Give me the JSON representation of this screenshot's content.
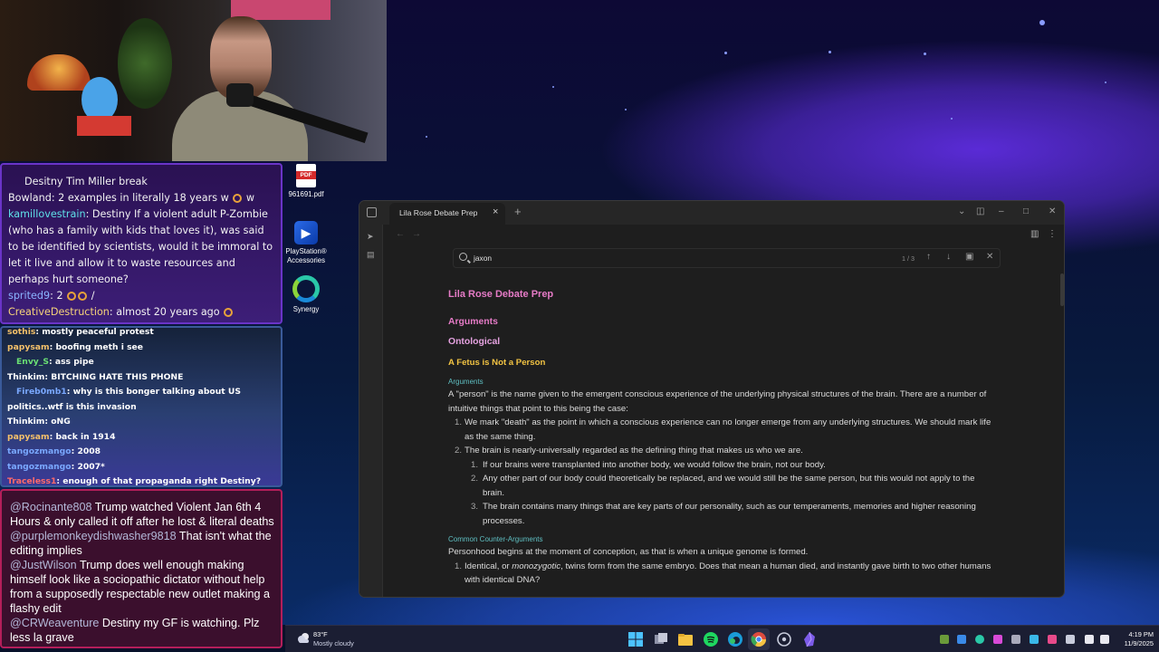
{
  "chat_overlay_1": {
    "messages": [
      {
        "user": "",
        "text": "Desitny Tim Miller break"
      },
      {
        "user": "Bowland",
        "text": ": 2 examples in literally 18 years w",
        "suffix": "w"
      },
      {
        "user": "kamillovestrain",
        "text": ": Destiny If a violent adult P-Zombie (who has a family with kids that loves it), was said to be identified by scientists, would it be immoral to let it live and allow it to waste resources and perhaps hurt someone?"
      },
      {
        "user": "sprited9",
        "text": ": 2",
        "suffix": "/"
      },
      {
        "user": "CreativeDestruction",
        "text": ": almost 20 years ago"
      }
    ]
  },
  "chat_overlay_2": {
    "messages": [
      {
        "user": "sothis",
        "text": ": mostly peaceful protest"
      },
      {
        "user": "papysam",
        "text": ": boofing meth i see"
      },
      {
        "user": "Envy_S",
        "text": ": ass pipe"
      },
      {
        "user": "Thinkim",
        "text": ": BITCHING HATE THIS PHONE"
      },
      {
        "user": "Fireb0mb1",
        "text": ": why is this bonger talking about US politics..wtf is this invasion"
      },
      {
        "user": "Thinkim",
        "text": ": oNG"
      },
      {
        "user": "papysam",
        "text": ": back in 1914"
      },
      {
        "user": "tangozmango",
        "text": ": 2008"
      },
      {
        "user": "tangozmango",
        "text": ": 2007*"
      },
      {
        "user": "Traceless1",
        "text": ": enough of that propaganda right Destiny?"
      }
    ]
  },
  "chat_overlay_3": {
    "messages": [
      {
        "user": "@Rocinante808",
        "text": " Trump watched Violent Jan 6th 4 Hours & only called it off after he lost & literal deaths"
      },
      {
        "user": "@purplemonkeydishwasher9818",
        "text": " That isn't what the editing implies"
      },
      {
        "user": "@JustWilson",
        "text": " Trump does well enough making himself look like a sociopathic dictator without help from a supposedly respectable new outlet making a flashy edit"
      },
      {
        "user": "@CRWeaventure",
        "text": " Destiny my GF is watching. Plz less la grave"
      }
    ]
  },
  "desktop_icons": [
    {
      "label": "961691.pdf",
      "icon": "pdf-file-icon"
    },
    {
      "label": "PlayStation® Accessories",
      "icon": "playstation-icon"
    },
    {
      "label": "Synergy",
      "icon": "synergy-icon"
    }
  ],
  "obsidian": {
    "tab_title": "Lila Rose Debate Prep",
    "tab_close": "×",
    "new_tab": "+",
    "search": {
      "value": "jaxon",
      "count": "1 / 3"
    },
    "doc": {
      "title": "Lila Rose Debate Prep",
      "h_arguments": "Arguments",
      "h_ontological": "Ontological",
      "h_fetus": "A Fetus is Not a Person",
      "h_arguments_small": "Arguments",
      "p1": "A \"person\" is the name given to the emergent conscious experience of the underlying physical structures of the brain. There are a number of intuitive things that point to this being the case:",
      "li1": "We mark \"death\" as the point in which a conscious experience can no longer emerge from any underlying structures. We should mark life as the same thing.",
      "li2": "The brain is nearly-universally regarded as the defining thing that makes us who we are.",
      "li2_1": "If our brains were transplanted into another body, we would follow the brain, not our body.",
      "li2_2": "Any other part of our body could theoretically be replaced, and we would still be the same person, but this would not apply to the brain.",
      "li2_3": "The brain contains many things that are key parts of our personality, such as our temperaments, memories and higher reasoning processes.",
      "h_counter": "Common Counter-Arguments",
      "p2": "Personhood begins at the moment of conception, as that is when a unique genome is formed.",
      "li3_a": "Identical, or ",
      "li3_em": "monozygotic",
      "li3_b": ", twins form from the same embryo. Does that mean a human died, and instantly gave birth to two other humans with identical DNA?"
    }
  },
  "taskbar": {
    "weather_temp": "83°F",
    "weather_desc": "Mostly cloudy",
    "time": "4:19 PM",
    "date": "11/9/2025"
  },
  "colors": {
    "heading_pink": "#e57bc6",
    "heading_yellow": "#f3c443",
    "heading_teal": "#5fbfc2"
  }
}
